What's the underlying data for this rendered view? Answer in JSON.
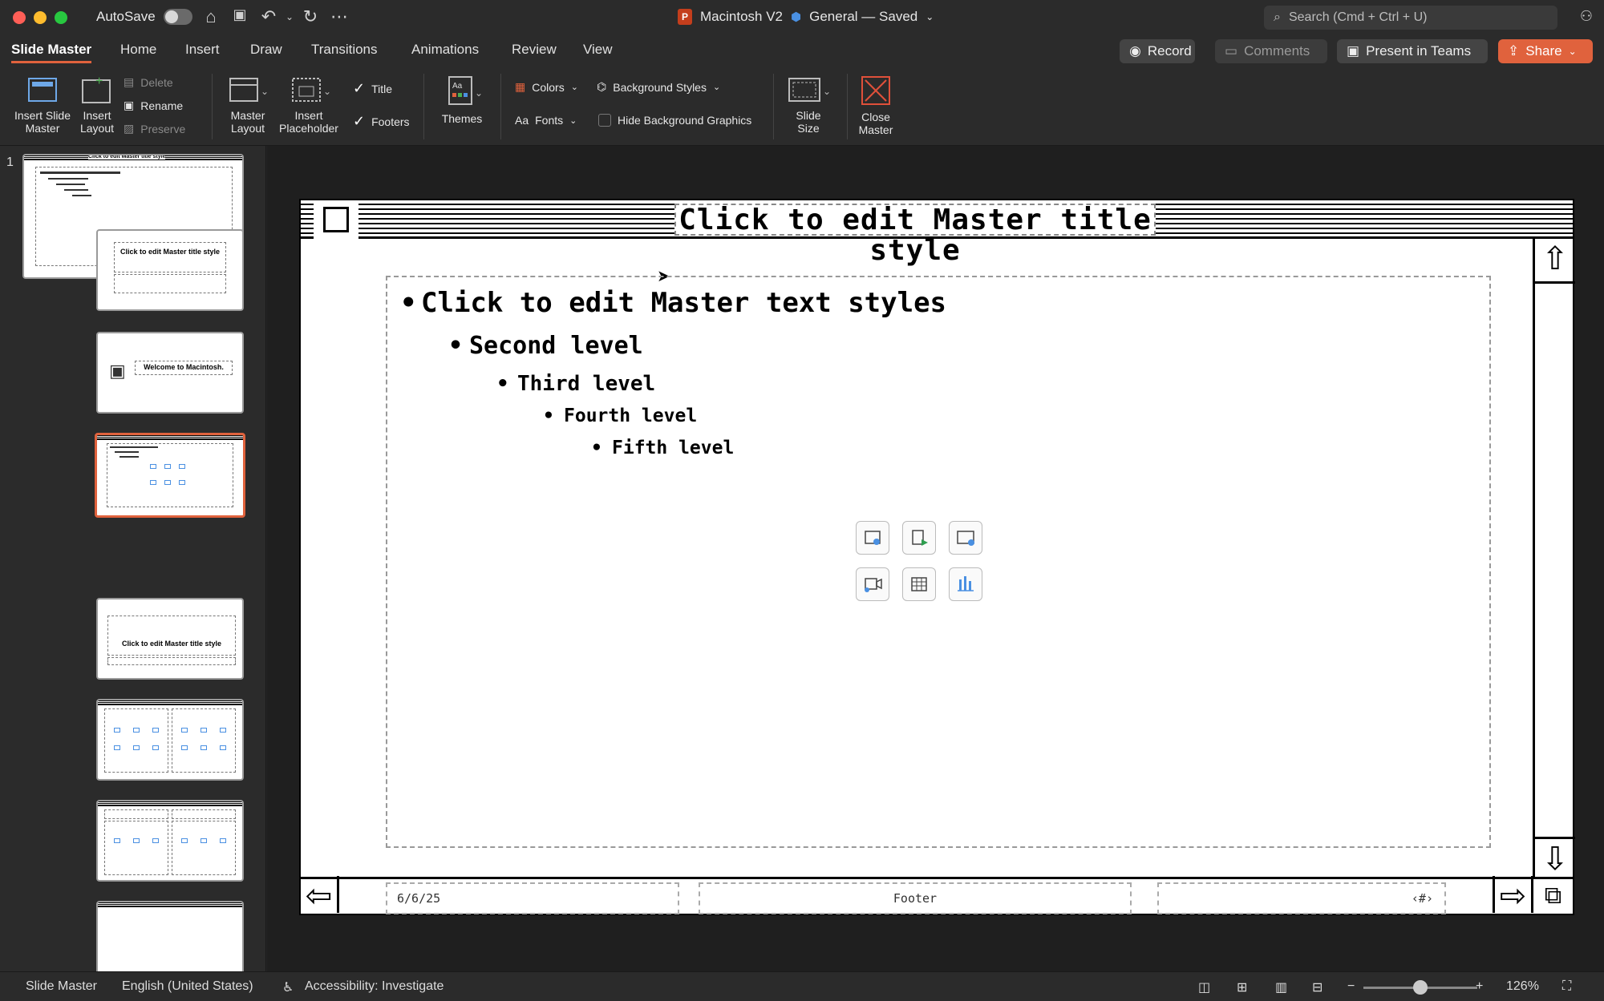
{
  "window": {
    "autosave_label": "AutoSave",
    "doc_title": "Macintosh V2",
    "status": "General — Saved",
    "search_placeholder": "Search (Cmd + Ctrl + U)"
  },
  "tabs": [
    {
      "label": "Slide Master"
    },
    {
      "label": "Home"
    },
    {
      "label": "Insert"
    },
    {
      "label": "Draw"
    },
    {
      "label": "Transitions"
    },
    {
      "label": "Animations"
    },
    {
      "label": "Review"
    },
    {
      "label": "View"
    }
  ],
  "actions": {
    "record": "Record",
    "comments": "Comments",
    "teams": "Present in Teams",
    "share": "Share"
  },
  "ribbon": {
    "insert_slide_master_1": "Insert Slide",
    "insert_slide_master_2": "Master",
    "insert_layout_1": "Insert",
    "insert_layout_2": "Layout",
    "delete": "Delete",
    "rename": "Rename",
    "preserve": "Preserve",
    "master_layout_1": "Master",
    "master_layout_2": "Layout",
    "insert_placeholder_1": "Insert",
    "insert_placeholder_2": "Placeholder",
    "title": "Title",
    "footers": "Footers",
    "themes": "Themes",
    "colors": "Colors",
    "fonts": "Fonts",
    "background_styles": "Background Styles",
    "hide_background_graphics": "Hide Background Graphics",
    "slide_size_1": "Slide",
    "slide_size_2": "Size",
    "close_master_1": "Close",
    "close_master_2": "Master"
  },
  "thumbnails": {
    "slide_number": "1",
    "master_title": "Click to edit Master title style",
    "title_slide_title": "Click to edit Master title style",
    "welcome": "Welcome to Macintosh.",
    "section_title": "Click to edit Master title style"
  },
  "slide": {
    "title": "Click to edit Master title style",
    "levels": [
      "Click to edit Master text styles",
      "Second level",
      "Third level",
      "Fourth level",
      "Fifth level"
    ],
    "footer_date": "6/6/25",
    "footer_text": "Footer",
    "footer_number": "‹#›"
  },
  "statusbar": {
    "view": "Slide Master",
    "language": "English (United States)",
    "accessibility": "Accessibility: Investigate",
    "zoom": "126%"
  },
  "colors": {
    "accent": "#e0623d",
    "chrome": "#2b2b2b"
  }
}
